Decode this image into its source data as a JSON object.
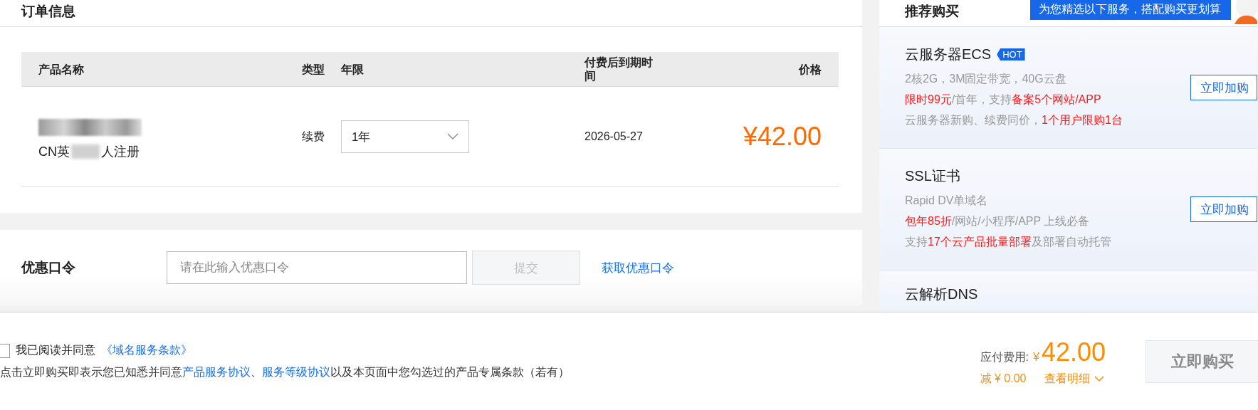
{
  "order": {
    "title": "订单信息",
    "columns": [
      "产品名称",
      "类型",
      "年限",
      "付费后到期时间",
      "价格"
    ],
    "rows": [
      {
        "name_visible": [
          "CN英",
          "人注册"
        ],
        "type": "续费",
        "period": "1年",
        "expiry": "2026-05-27",
        "price": "¥42.00"
      }
    ]
  },
  "coupon": {
    "label": "优惠口令",
    "placeholder": "请在此输入优惠口令",
    "submit": "提交",
    "submit_disabled": true,
    "link": "获取优惠口令"
  },
  "recommend": {
    "title": "推荐购买",
    "banner": "为您精选以下服务，搭配购买更划算",
    "items": [
      {
        "name": "云服务器ECS",
        "badge": "HOT",
        "button": "立即加购",
        "lines": [
          [
            {
              "text": "2核2G，3M固定带宽，40G云盘",
              "highlight": false
            }
          ],
          [
            {
              "text": "限时99元",
              "highlight": true
            },
            {
              "text": "/首年，支持",
              "highlight": false
            },
            {
              "text": "备案5个网站/APP",
              "highlight": true
            }
          ],
          [
            {
              "text": "云服务器新购、续费同价，",
              "highlight": false
            },
            {
              "text": "1个用户限购1台",
              "highlight": true
            }
          ]
        ]
      },
      {
        "name": "SSL证书",
        "button": "立即加购",
        "lines": [
          [
            {
              "text": "Rapid DV单域名",
              "highlight": false
            }
          ],
          [
            {
              "text": "包年85折",
              "highlight": true
            },
            {
              "text": "/网站/小程序/APP 上线必备",
              "highlight": false
            }
          ],
          [
            {
              "text": "支持",
              "highlight": false
            },
            {
              "text": "17个云产品批量部署",
              "highlight": true
            },
            {
              "text": "及部署自动托管",
              "highlight": false
            }
          ]
        ]
      },
      {
        "name": "云解析DNS"
      }
    ]
  },
  "footer": {
    "agree_checked": false,
    "agree_text": "我已阅读并同意",
    "agree_link": "《域名服务条款》",
    "notice": [
      {
        "text": "点击立即购买即表示您已知悉并同意",
        "kind": "text"
      },
      {
        "text": "产品服务协议",
        "kind": "link"
      },
      {
        "text": "、",
        "kind": "text"
      },
      {
        "text": "服务等级协议",
        "kind": "link"
      },
      {
        "text": "以及本页面中您勾选过的产品专属条款（若有）",
        "kind": "text"
      }
    ],
    "total_label": "应付费用:",
    "currency": "¥",
    "total": "42.00",
    "discount": "减 ¥ 0.00",
    "details": "查看明细",
    "buy": "立即购买",
    "buy_disabled": true
  }
}
